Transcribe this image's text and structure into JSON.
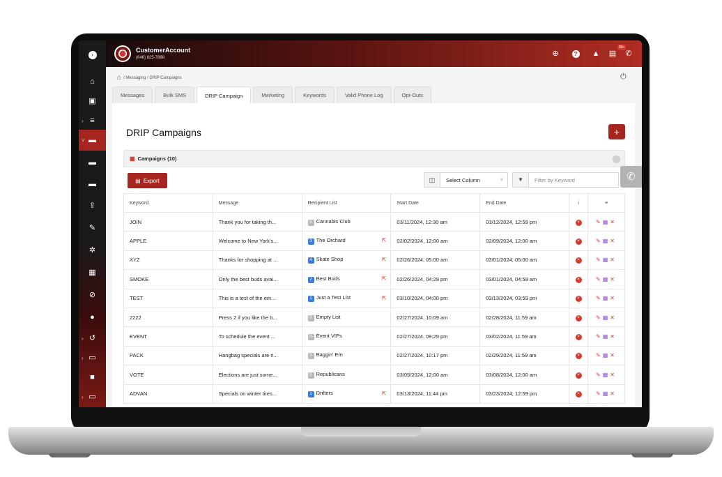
{
  "header": {
    "account_name": "CustomerAccount",
    "account_phone": "(646) 825-7888",
    "badge": "99+"
  },
  "breadcrumb": "/ Messaging / DRIP Campaigns",
  "tabs": [
    "Messages",
    "Bulk SMS",
    "DRIP Campaign",
    "Marketing",
    "Keywords",
    "Valid Phone Log",
    "Opt-Outs"
  ],
  "active_tab": "DRIP Campaign",
  "page_title": "DRIP Campaigns",
  "add_label": "+",
  "card_title": "Campaigns (10)",
  "export_label": "Export",
  "select_column_label": "Select Column",
  "filter_placeholder": "Filter by Keyword",
  "columns": [
    "Keyword",
    "Message",
    "Recipient List",
    "Start Date",
    "End Date",
    "i",
    "≡"
  ],
  "rows": [
    {
      "keyword": "JOIN",
      "message": "Thank you for taking th...",
      "count": "0",
      "list": "Cannabis Club",
      "link": false,
      "start": "03/11/2024, 12:30 am",
      "end": "03/12/2024, 12:59 pm"
    },
    {
      "keyword": "APPLE",
      "message": "Welcome to New York's...",
      "count": "3",
      "list": "The Orchard",
      "link": true,
      "start": "02/02/2024, 12:00 am",
      "end": "02/09/2024, 12:00 am"
    },
    {
      "keyword": "XYZ",
      "message": "Thanks for shopping at ...",
      "count": "4",
      "list": "Skate Shop",
      "link": true,
      "start": "02/26/2024, 05:00 am",
      "end": "03/01/2024, 05:00 am"
    },
    {
      "keyword": "SMOKE",
      "message": "Only the best buds avai...",
      "count": "2",
      "list": "Best Buds",
      "link": true,
      "start": "02/26/2024, 04:29 pm",
      "end": "03/01/2024, 04:59 am"
    },
    {
      "keyword": "TEST",
      "message": "This is a test of the em...",
      "count": "1",
      "list": "Just a Test List",
      "link": true,
      "start": "03/10/2024, 04:00 pm",
      "end": "03/13/2024, 03:59 pm"
    },
    {
      "keyword": "2222",
      "message": "Press 2 if you like the b...",
      "count": "0",
      "list": "Empty List",
      "link": false,
      "start": "02/27/2024, 10:09 am",
      "end": "02/28/2024, 11:59 am"
    },
    {
      "keyword": "EVENT",
      "message": "To schedule the event ...",
      "count": "0",
      "list": "Event VIPs",
      "link": false,
      "start": "02/27/2024, 09:29 pm",
      "end": "03/02/2024, 11:59 am"
    },
    {
      "keyword": "PACK",
      "message": "Hangbag specials are ri...",
      "count": "0",
      "list": "Baggin' Em",
      "link": false,
      "start": "02/27/2024, 10:17 pm",
      "end": "02/29/2024, 11:59 am"
    },
    {
      "keyword": "VOTE",
      "message": "Elections are just some...",
      "count": "0",
      "list": "Republicans",
      "link": false,
      "start": "03/05/2024, 12:00 am",
      "end": "03/08/2024, 12:00 am"
    },
    {
      "keyword": "ADVAN",
      "message": "Specials on winter tires...",
      "count": "1",
      "list": "Drifters",
      "link": true,
      "start": "03/13/2024, 11:44 pm",
      "end": "03/23/2024, 12:59 pm"
    }
  ]
}
